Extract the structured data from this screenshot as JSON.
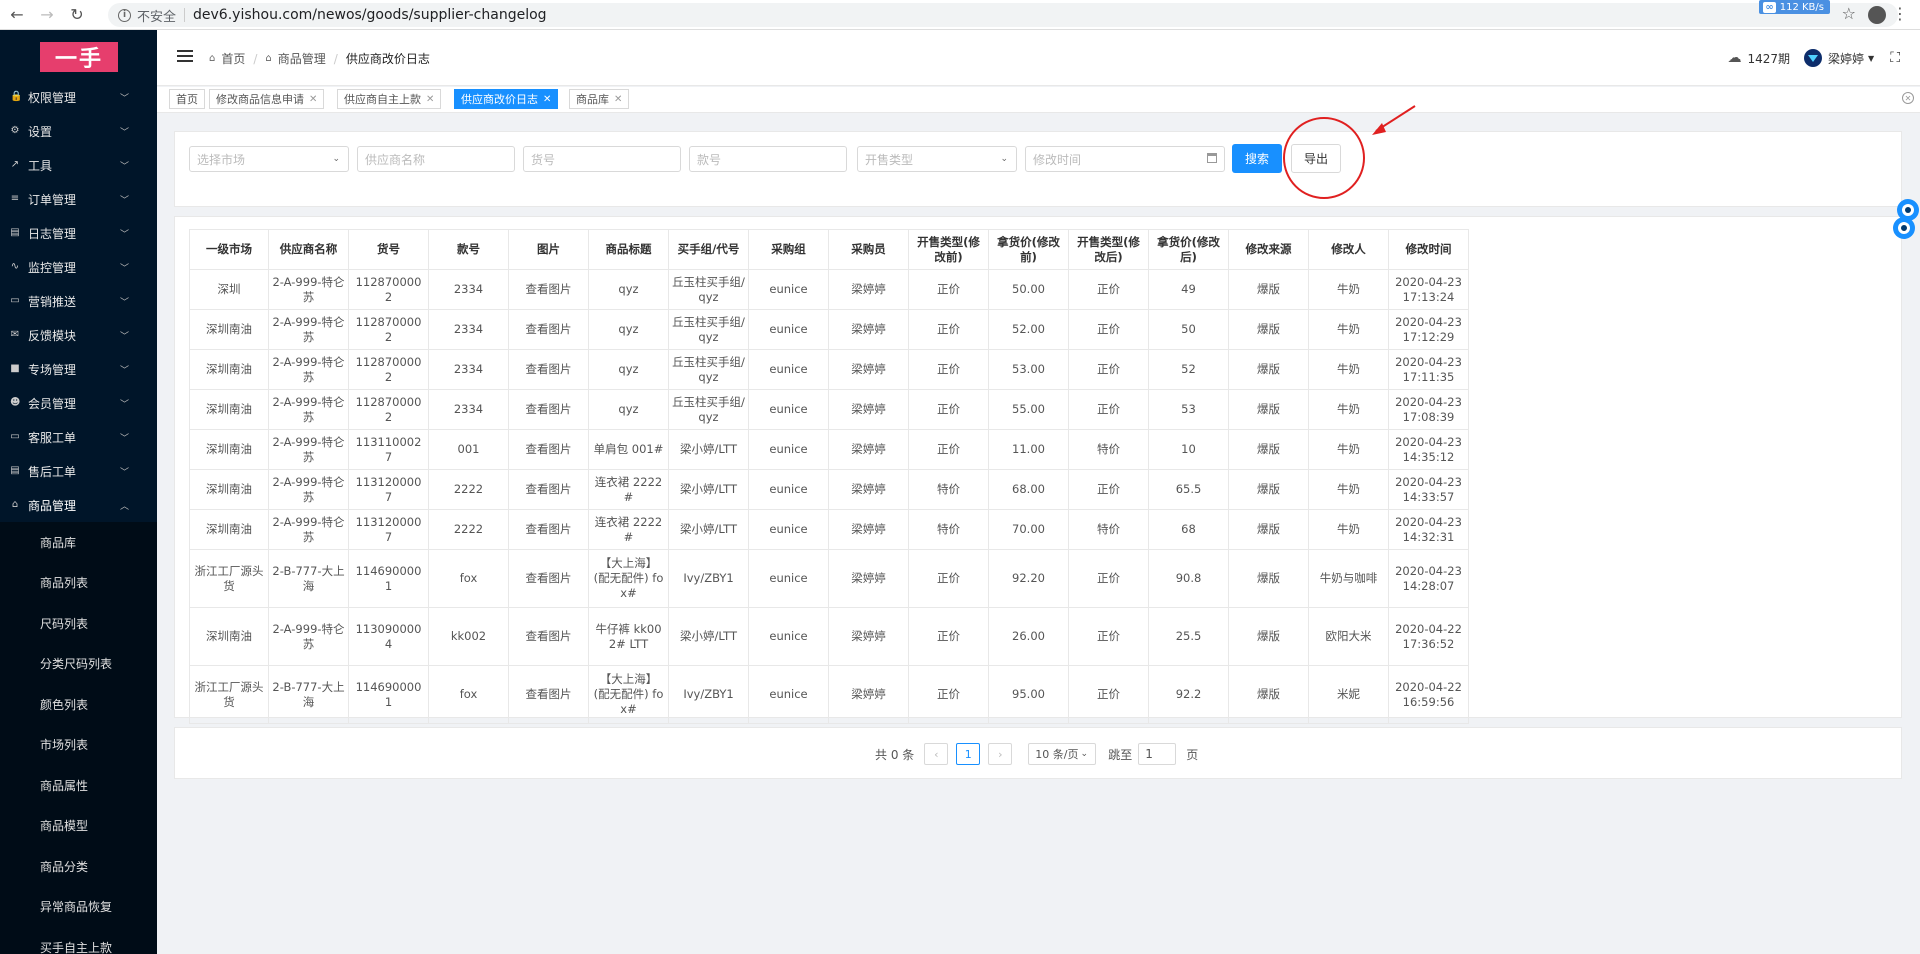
{
  "browser": {
    "insecure_label": "不安全",
    "url": "dev6.yishou.com/newos/goods/supplier-changelog",
    "speed_label": "112 KB/s"
  },
  "sidebar": {
    "logo_text": "一手",
    "menu": [
      {
        "label": "权限管理",
        "icon": "lock-icon"
      },
      {
        "label": "设置",
        "icon": "gear-icon"
      },
      {
        "label": "工具",
        "icon": "tool-icon"
      },
      {
        "label": "订单管理",
        "icon": "list-icon"
      },
      {
        "label": "日志管理",
        "icon": "doc-icon"
      },
      {
        "label": "监控管理",
        "icon": "pulse-icon"
      },
      {
        "label": "营销推送",
        "icon": "card-icon"
      },
      {
        "label": "反馈模块",
        "icon": "mail-icon"
      },
      {
        "label": "专场管理",
        "icon": "square-icon"
      },
      {
        "label": "会员管理",
        "icon": "users-icon"
      },
      {
        "label": "客服工单",
        "icon": "card-icon"
      },
      {
        "label": "售后工单",
        "icon": "doc-icon"
      },
      {
        "label": "商品管理",
        "icon": "home-icon"
      }
    ],
    "submenu": [
      "商品库",
      "商品列表",
      "尺码列表",
      "分类尺码列表",
      "颜色列表",
      "市场列表",
      "商品属性",
      "商品模型",
      "商品分类",
      "异常商品恢复",
      "买手自主上款"
    ]
  },
  "header": {
    "breadcrumb": [
      "首页",
      "商品管理",
      "供应商改价日志"
    ],
    "period": "1427期",
    "user_name": "梁婷婷"
  },
  "tabs": [
    {
      "label": "首页",
      "closable": false,
      "active": false
    },
    {
      "label": "修改商品信息申请",
      "closable": true,
      "active": false
    },
    {
      "label": "供应商自主上款",
      "closable": true,
      "active": false
    },
    {
      "label": "供应商改价日志",
      "closable": true,
      "active": true
    },
    {
      "label": "商品库",
      "closable": true,
      "active": false
    }
  ],
  "filters": {
    "market_placeholder": "选择市场",
    "supplier_placeholder": "供应商名称",
    "goods_no_placeholder": "货号",
    "style_no_placeholder": "款号",
    "sale_type_placeholder": "开售类型",
    "time_placeholder": "修改时间",
    "search_label": "搜索",
    "export_label": "导出"
  },
  "table": {
    "headers": [
      "一级市场",
      "供应商名称",
      "货号",
      "款号",
      "图片",
      "商品标题",
      "买手组/代号",
      "采购组",
      "采购员",
      "开售类型(修改前)",
      "拿货价(修改前)",
      "开售类型(修改后)",
      "拿货价(修改后)",
      "修改来源",
      "修改人",
      "修改时间"
    ],
    "rows": [
      [
        "深圳",
        "2-A-999-特仑苏",
        "1128700002",
        "2334",
        "查看图片",
        "qyz",
        "丘玉柱买手组/qyz",
        "eunice",
        "梁婷婷",
        "正价",
        "50.00",
        "正价",
        "49",
        "爆版",
        "牛奶",
        "2020-04-23 17:13:24"
      ],
      [
        "深圳南油",
        "2-A-999-特仑苏",
        "1128700002",
        "2334",
        "查看图片",
        "qyz",
        "丘玉柱买手组/qyz",
        "eunice",
        "梁婷婷",
        "正价",
        "52.00",
        "正价",
        "50",
        "爆版",
        "牛奶",
        "2020-04-23 17:12:29"
      ],
      [
        "深圳南油",
        "2-A-999-特仑苏",
        "1128700002",
        "2334",
        "查看图片",
        "qyz",
        "丘玉柱买手组/qyz",
        "eunice",
        "梁婷婷",
        "正价",
        "53.00",
        "正价",
        "52",
        "爆版",
        "牛奶",
        "2020-04-23 17:11:35"
      ],
      [
        "深圳南油",
        "2-A-999-特仑苏",
        "1128700002",
        "2334",
        "查看图片",
        "qyz",
        "丘玉柱买手组/qyz",
        "eunice",
        "梁婷婷",
        "正价",
        "55.00",
        "正价",
        "53",
        "爆版",
        "牛奶",
        "2020-04-23 17:08:39"
      ],
      [
        "深圳南油",
        "2-A-999-特仑苏",
        "1131100027",
        "001",
        "查看图片",
        "单肩包 001#",
        "梁小婷/LTT",
        "eunice",
        "梁婷婷",
        "正价",
        "11.00",
        "特价",
        "10",
        "爆版",
        "牛奶",
        "2020-04-23 14:35:12"
      ],
      [
        "深圳南油",
        "2-A-999-特仑苏",
        "1131200007",
        "2222",
        "查看图片",
        "连衣裙 2222#",
        "梁小婷/LTT",
        "eunice",
        "梁婷婷",
        "特价",
        "68.00",
        "正价",
        "65.5",
        "爆版",
        "牛奶",
        "2020-04-23 14:33:57"
      ],
      [
        "深圳南油",
        "2-A-999-特仑苏",
        "1131200007",
        "2222",
        "查看图片",
        "连衣裙 2222#",
        "梁小婷/LTT",
        "eunice",
        "梁婷婷",
        "特价",
        "70.00",
        "特价",
        "68",
        "爆版",
        "牛奶",
        "2020-04-23 14:32:31"
      ],
      [
        "浙江工厂源头货",
        "2-B-777-大上海",
        "1146900001",
        "fox",
        "查看图片",
        "【大上海】(配无配件) fox#",
        "Ivy/ZBY1",
        "eunice",
        "梁婷婷",
        "正价",
        "92.20",
        "正价",
        "90.8",
        "爆版",
        "牛奶与咖啡",
        "2020-04-23 14:28:07"
      ],
      [
        "深圳南油",
        "2-A-999-特仑苏",
        "1130900004",
        "kk002",
        "查看图片",
        "牛仔裤 kk002# LTT",
        "梁小婷/LTT",
        "eunice",
        "梁婷婷",
        "正价",
        "26.00",
        "正价",
        "25.5",
        "爆版",
        "欧阳大米",
        "2020-04-22 17:36:52"
      ],
      [
        "浙江工厂源头货",
        "2-B-777-大上海",
        "1146900001",
        "fox",
        "查看图片",
        "【大上海】(配无配件) fox#",
        "Ivy/ZBY1",
        "eunice",
        "梁婷婷",
        "正价",
        "95.00",
        "正价",
        "92.2",
        "爆版",
        "米妮",
        "2020-04-22 16:59:56"
      ]
    ]
  },
  "pagination": {
    "total_label": "共 0 条",
    "current_page": "1",
    "page_size_label": "10 条/页",
    "jump_label": "跳至",
    "jump_value": "1",
    "page_suffix": "页"
  },
  "colors": {
    "primary": "#1890ff",
    "sidebar_bg": "#001529",
    "logo": "#e63e6d",
    "annotation": "#e02020"
  }
}
